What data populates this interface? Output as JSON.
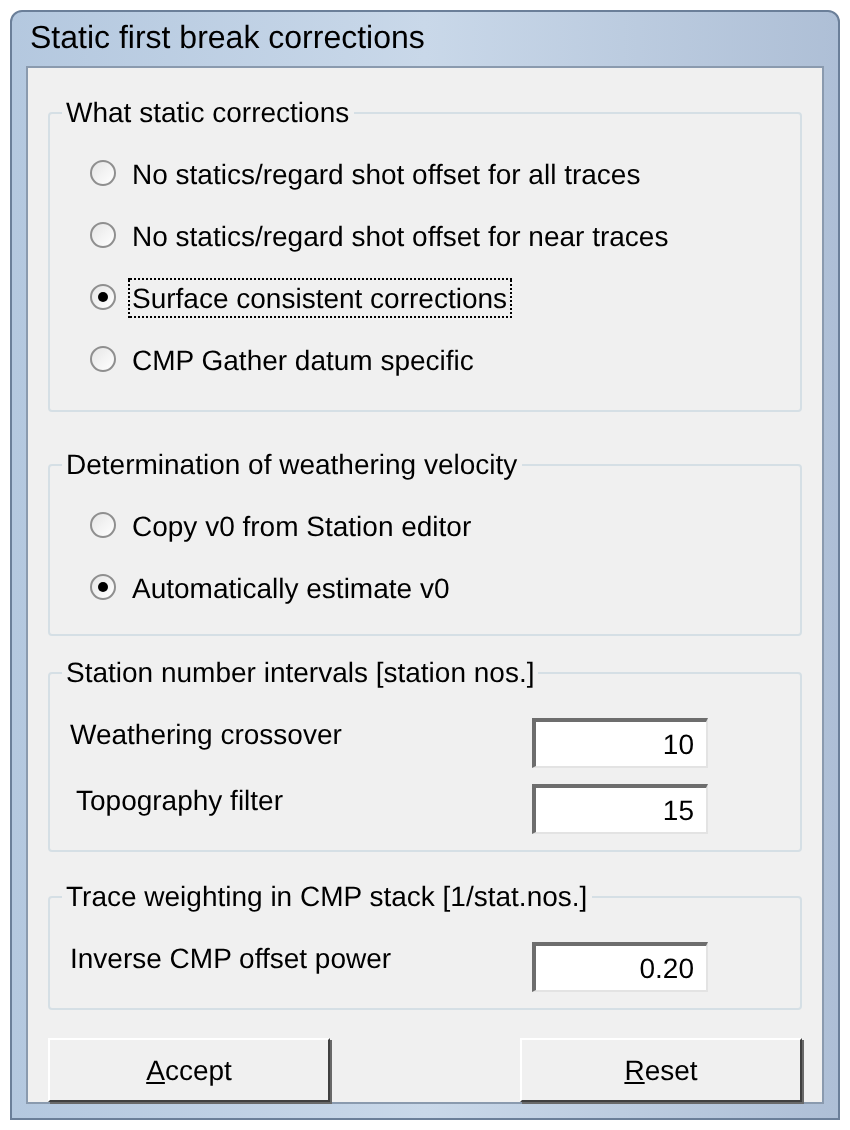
{
  "window": {
    "title": "Static first break corrections"
  },
  "groups": [
    {
      "title": "What static corrections",
      "kind": "radios",
      "items": [
        {
          "label": "No statics/regard shot offset for all traces",
          "selected": false,
          "focused": false
        },
        {
          "label": "No statics/regard shot offset for near traces",
          "selected": false,
          "focused": false
        },
        {
          "label": "Surface consistent corrections",
          "selected": true,
          "focused": true
        },
        {
          "label": "CMP Gather datum specific",
          "selected": false,
          "focused": false
        }
      ]
    },
    {
      "title": "Determination of weathering velocity",
      "kind": "radios",
      "items": [
        {
          "label": "Copy v0 from Station editor",
          "selected": false,
          "focused": false
        },
        {
          "label": "Automatically estimate v0",
          "selected": true,
          "focused": false
        }
      ]
    },
    {
      "title": "Station number intervals [station nos.]",
      "kind": "fields",
      "items": [
        {
          "label": "Weathering crossover",
          "value": "10"
        },
        {
          "label": "Topography filter",
          "value": "15"
        }
      ]
    },
    {
      "title": "Trace weighting in CMP stack [1/stat.nos.]",
      "kind": "fields",
      "items": [
        {
          "label": "Inverse CMP offset power",
          "value": "0.20"
        }
      ]
    }
  ],
  "buttons": [
    {
      "label": "Accept",
      "underline_first": true
    },
    {
      "label": "Reset",
      "underline_first": true
    }
  ]
}
